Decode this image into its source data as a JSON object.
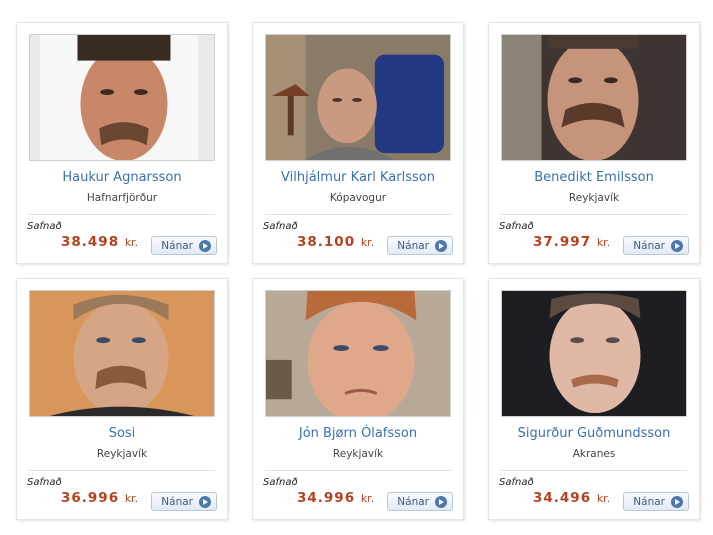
{
  "labels": {
    "collected": "Safnað",
    "currency": "kr.",
    "more_button": "Nánar"
  },
  "colors": {
    "name_link": "#3b6fb0",
    "amount": "#b2421f",
    "button_text": "#365d8a"
  },
  "participants": [
    {
      "name": "Haukur Agnarsson",
      "place": "Hafnarfjörður",
      "amount": "38.498"
    },
    {
      "name": "Vilhjálmur Karl Karlsson",
      "place": "Kópavogur",
      "amount": "38.100"
    },
    {
      "name": "Benedikt Emilsson",
      "place": "Reykjavík",
      "amount": "37.997"
    },
    {
      "name": "Sosi",
      "place": "Reykjavík",
      "amount": "36.996"
    },
    {
      "name": "Jón Bjørn Ólafsson",
      "place": "Reykjavík",
      "amount": "34.996"
    },
    {
      "name": "Sigurður Guðmundsson",
      "place": "Akranes",
      "amount": "34.496"
    }
  ]
}
